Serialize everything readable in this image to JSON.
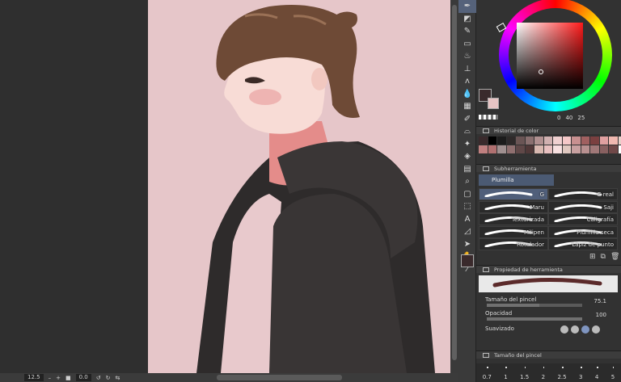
{
  "status_bar": {
    "zoom": "12.5",
    "rotation": "0.0"
  },
  "color_panel": {
    "main_color": "#3a2a2c",
    "sub_color": "#e7c4c4",
    "values": [
      "0",
      "40",
      "25"
    ]
  },
  "color_history": {
    "title": "Historial de color",
    "swatches": [
      "#3a2a2c",
      "#000000",
      "#1c1c1c",
      "#2f2a2a",
      "#6a5555",
      "#8a7070",
      "#b09090",
      "#d0b0b0",
      "#f0d0d0",
      "#f5c8c8",
      "#c89090",
      "#a06060",
      "#7a4040",
      "#e0a0a0",
      "#f0b8b0",
      "#e8d0c8",
      "#c08080",
      "#b07070",
      "#a09090",
      "#907070",
      "#604848",
      "#503838",
      "#d8b8b0",
      "#e8c0c0",
      "#f8e0e0",
      "#e0c8c0",
      "#c8a0a0",
      "#b89090",
      "#a07878",
      "#886060",
      "#704848",
      "#ffffff"
    ]
  },
  "subtool": {
    "title": "Subherramienta",
    "tab": "Plumilla",
    "brushes": [
      {
        "name": "G",
        "selected": true
      },
      {
        "name": "G real",
        "selected": false
      },
      {
        "name": "Maru",
        "selected": false
      },
      {
        "name": "Saji",
        "selected": false
      },
      {
        "name": "Texturizada",
        "selected": false
      },
      {
        "name": "Caligrafía",
        "selected": false
      },
      {
        "name": "Milipen",
        "selected": false
      },
      {
        "name": "Plumilla seca",
        "selected": false
      },
      {
        "name": "Rotulador",
        "selected": false
      },
      {
        "name": "Lápiz de punto",
        "selected": false
      }
    ]
  },
  "tool_property": {
    "title": "Propiedad de herramienta",
    "brush_size_label": "Tamaño del pincel",
    "brush_size_value": "75.1",
    "brush_size_fraction": 0.55,
    "opacity_label": "Opacidad",
    "opacity_value": "100",
    "opacity_fraction": 1.0,
    "smoothing_label": "Suavizado"
  },
  "brush_size_panel": {
    "title": "Tamaño del pincel",
    "values": [
      "0.7",
      "1",
      "1.5",
      "2",
      "2.5",
      "3",
      "4",
      "5"
    ]
  },
  "tools": [
    "pen-icon",
    "color-mix-icon",
    "brush-icon",
    "eraser-icon",
    "fill-icon",
    "stamp-icon",
    "grass-icon",
    "drop-icon",
    "grid-icon",
    "eyedrop-icon",
    "lasso-icon",
    "sparkle-icon",
    "bucket-icon",
    "gradient-icon",
    "zoom-icon",
    "rect-select-icon",
    "transform-icon",
    "text-icon",
    "ruler-icon",
    "pointer-icon",
    "hand-icon",
    "spoid-icon"
  ]
}
